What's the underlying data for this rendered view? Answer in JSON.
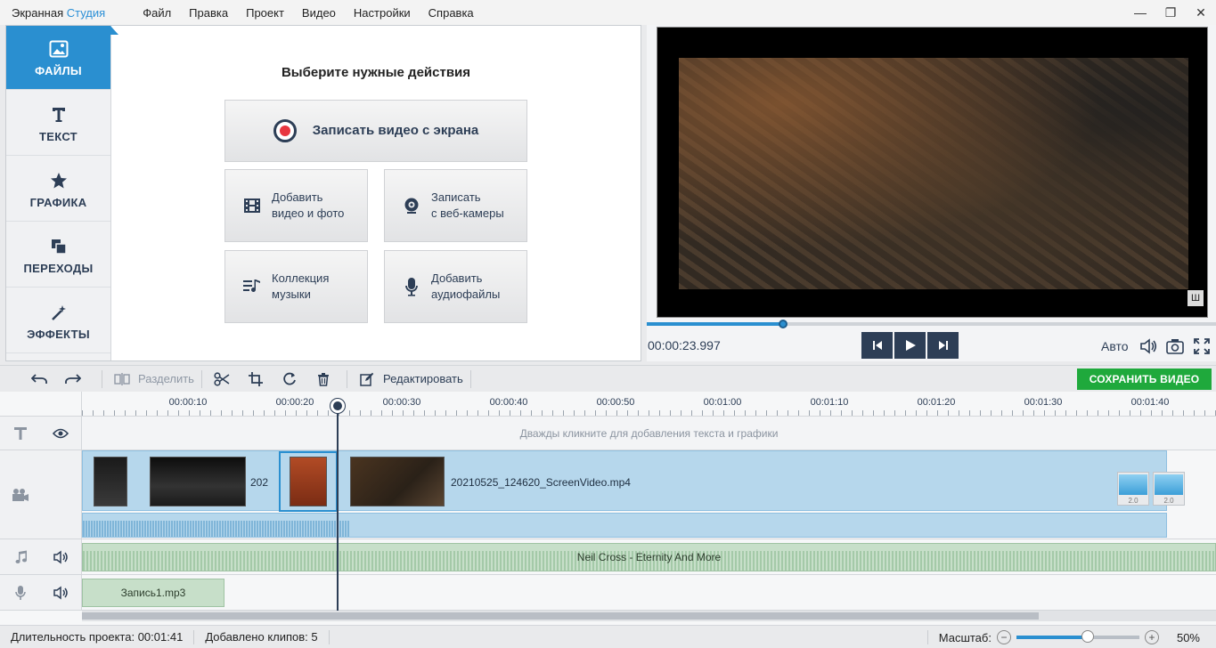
{
  "app": {
    "title_part1": "Экранная",
    "title_part2": "Студия"
  },
  "menu": [
    "Файл",
    "Правка",
    "Проект",
    "Видео",
    "Настройки",
    "Справка"
  ],
  "window_controls": {
    "minimize": "—",
    "maximize": "❐",
    "close": "✕"
  },
  "tabs": [
    {
      "label": "ФАЙЛЫ",
      "icon": "image-icon",
      "active": true
    },
    {
      "label": "ТЕКСТ",
      "icon": "text-icon"
    },
    {
      "label": "ГРАФИКА",
      "icon": "star-icon"
    },
    {
      "label": "ПЕРЕХОДЫ",
      "icon": "transitions-icon"
    },
    {
      "label": "ЭФФЕКТЫ",
      "icon": "magic-wand-icon"
    }
  ],
  "actions": {
    "title": "Выберите нужные действия",
    "record_screen": "Записать видео с экрана",
    "add_media_line1": "Добавить",
    "add_media_line2": "видео и фото",
    "webcam_line1": "Записать",
    "webcam_line2": "с веб-камеры",
    "music_line1": "Коллекция",
    "music_line2": "музыки",
    "audio_line1": "Добавить",
    "audio_line2": "аудиофайлы"
  },
  "preview": {
    "timecode": "00:00:23.997",
    "quality": "Авто",
    "progress_fraction": 0.24,
    "watermark": "Ш"
  },
  "toolbar": {
    "split": "Разделить",
    "edit": "Редактировать",
    "save": "СОХРАНИТЬ ВИДЕО"
  },
  "timeline": {
    "ruler_labels": [
      "00:00:10",
      "00:00:20",
      "00:00:30",
      "00:00:40",
      "00:00:50",
      "00:01:00",
      "00:01:10",
      "00:01:20",
      "00:01:30",
      "00:01:40"
    ],
    "text_hint": "Дважды кликните для добавления текста и графики",
    "clip_name": "20210525_124620_ScreenVideo.mp4",
    "clip_number_partial": "202",
    "transition_values": [
      "2.0",
      "2.0"
    ],
    "music_track": "Neil Cross - Eternity And More",
    "voice_clip": "Запись1.mp3"
  },
  "status": {
    "duration_label": "Длительность проекта:",
    "duration_value": "00:01:41",
    "clips_label": "Добавлено клипов:",
    "clips_value": "5",
    "zoom_label": "Масштаб:",
    "zoom_value": "50%",
    "zoom_fraction": 0.58
  }
}
